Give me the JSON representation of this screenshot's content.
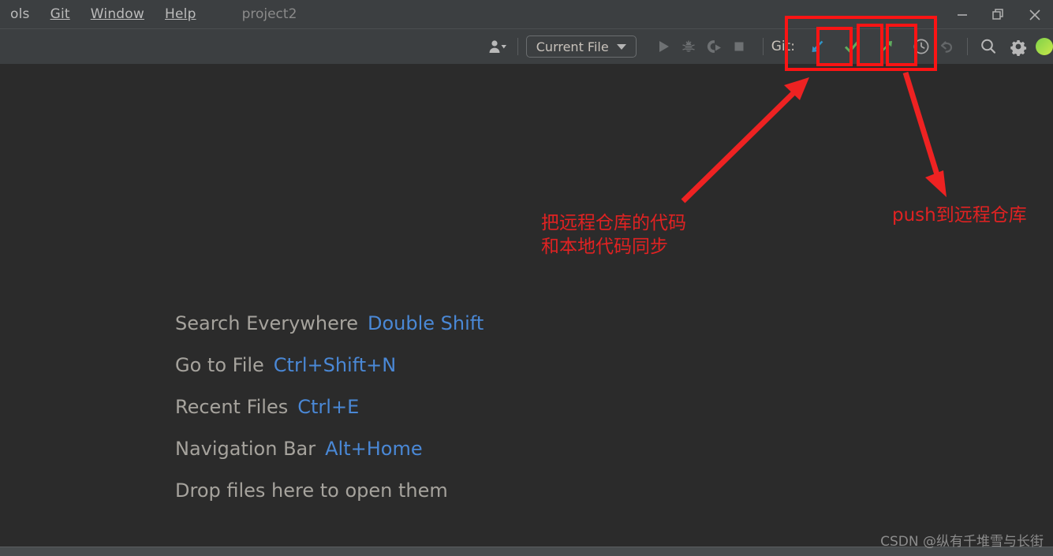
{
  "window": {
    "project_name": "project2",
    "controls": [
      {
        "name": "minimize-button",
        "glyph": "—"
      },
      {
        "name": "restore-button",
        "glyph": "restore-icon"
      },
      {
        "name": "close-button",
        "glyph": "×"
      }
    ]
  },
  "menu": {
    "items": [
      {
        "label": "ols",
        "mnemonic": "",
        "truncated": true
      },
      {
        "label": "Git",
        "mnemonic": "G"
      },
      {
        "label": "Window",
        "mnemonic": "W"
      },
      {
        "label": "Help",
        "mnemonic": "H"
      }
    ]
  },
  "toolbar": {
    "user_button": "user-icon",
    "run_config": {
      "label": "Current File",
      "dropdown": "chevron-down-icon"
    },
    "actions": [
      {
        "name": "run-button",
        "icon": "play-icon",
        "tooltip": "Run"
      },
      {
        "name": "debug-button",
        "icon": "bug-icon",
        "tooltip": "Debug"
      },
      {
        "name": "run-coverage-button",
        "icon": "coverage-icon",
        "tooltip": "Run with Coverage"
      },
      {
        "name": "stop-button",
        "icon": "stop-icon",
        "tooltip": "Stop"
      }
    ],
    "git": {
      "label": "Git:",
      "actions": [
        {
          "name": "git-update-button",
          "icon": "arrow-down-left-icon",
          "color": "#3592c4",
          "tooltip": "Update Project"
        },
        {
          "name": "git-commit-button",
          "icon": "checkmark-icon",
          "color": "#5fad5f",
          "tooltip": "Commit"
        },
        {
          "name": "git-push-button",
          "icon": "arrow-up-right-icon",
          "color": "#5fad5f",
          "tooltip": "Push"
        }
      ],
      "history_button": {
        "name": "git-history-button",
        "icon": "clock-icon"
      },
      "rollback_button": {
        "name": "git-rollback-button",
        "icon": "undo-icon"
      }
    },
    "search_button": {
      "name": "search-button",
      "icon": "search-icon"
    },
    "settings_button": {
      "name": "settings-button",
      "icon": "gear-icon"
    },
    "avatar": {
      "name": "user-avatar",
      "color": "#7fd14a"
    }
  },
  "editor": {
    "shortcuts": [
      {
        "label": "Search Everywhere",
        "key": "Double Shift"
      },
      {
        "label": "Go to File",
        "key": "Ctrl+Shift+N"
      },
      {
        "label": "Recent Files",
        "key": "Ctrl+E"
      },
      {
        "label": "Navigation Bar",
        "key": "Alt+Home"
      }
    ],
    "drop_hint": "Drop files here to open them"
  },
  "annotations": {
    "color": "#e02222",
    "box_color": "#fb1414",
    "note_sync": "把远程仓库的代码\n和本地代码同步",
    "note_push": "push到远程仓库"
  },
  "watermark": "CSDN @纵有千堆雪与长街"
}
